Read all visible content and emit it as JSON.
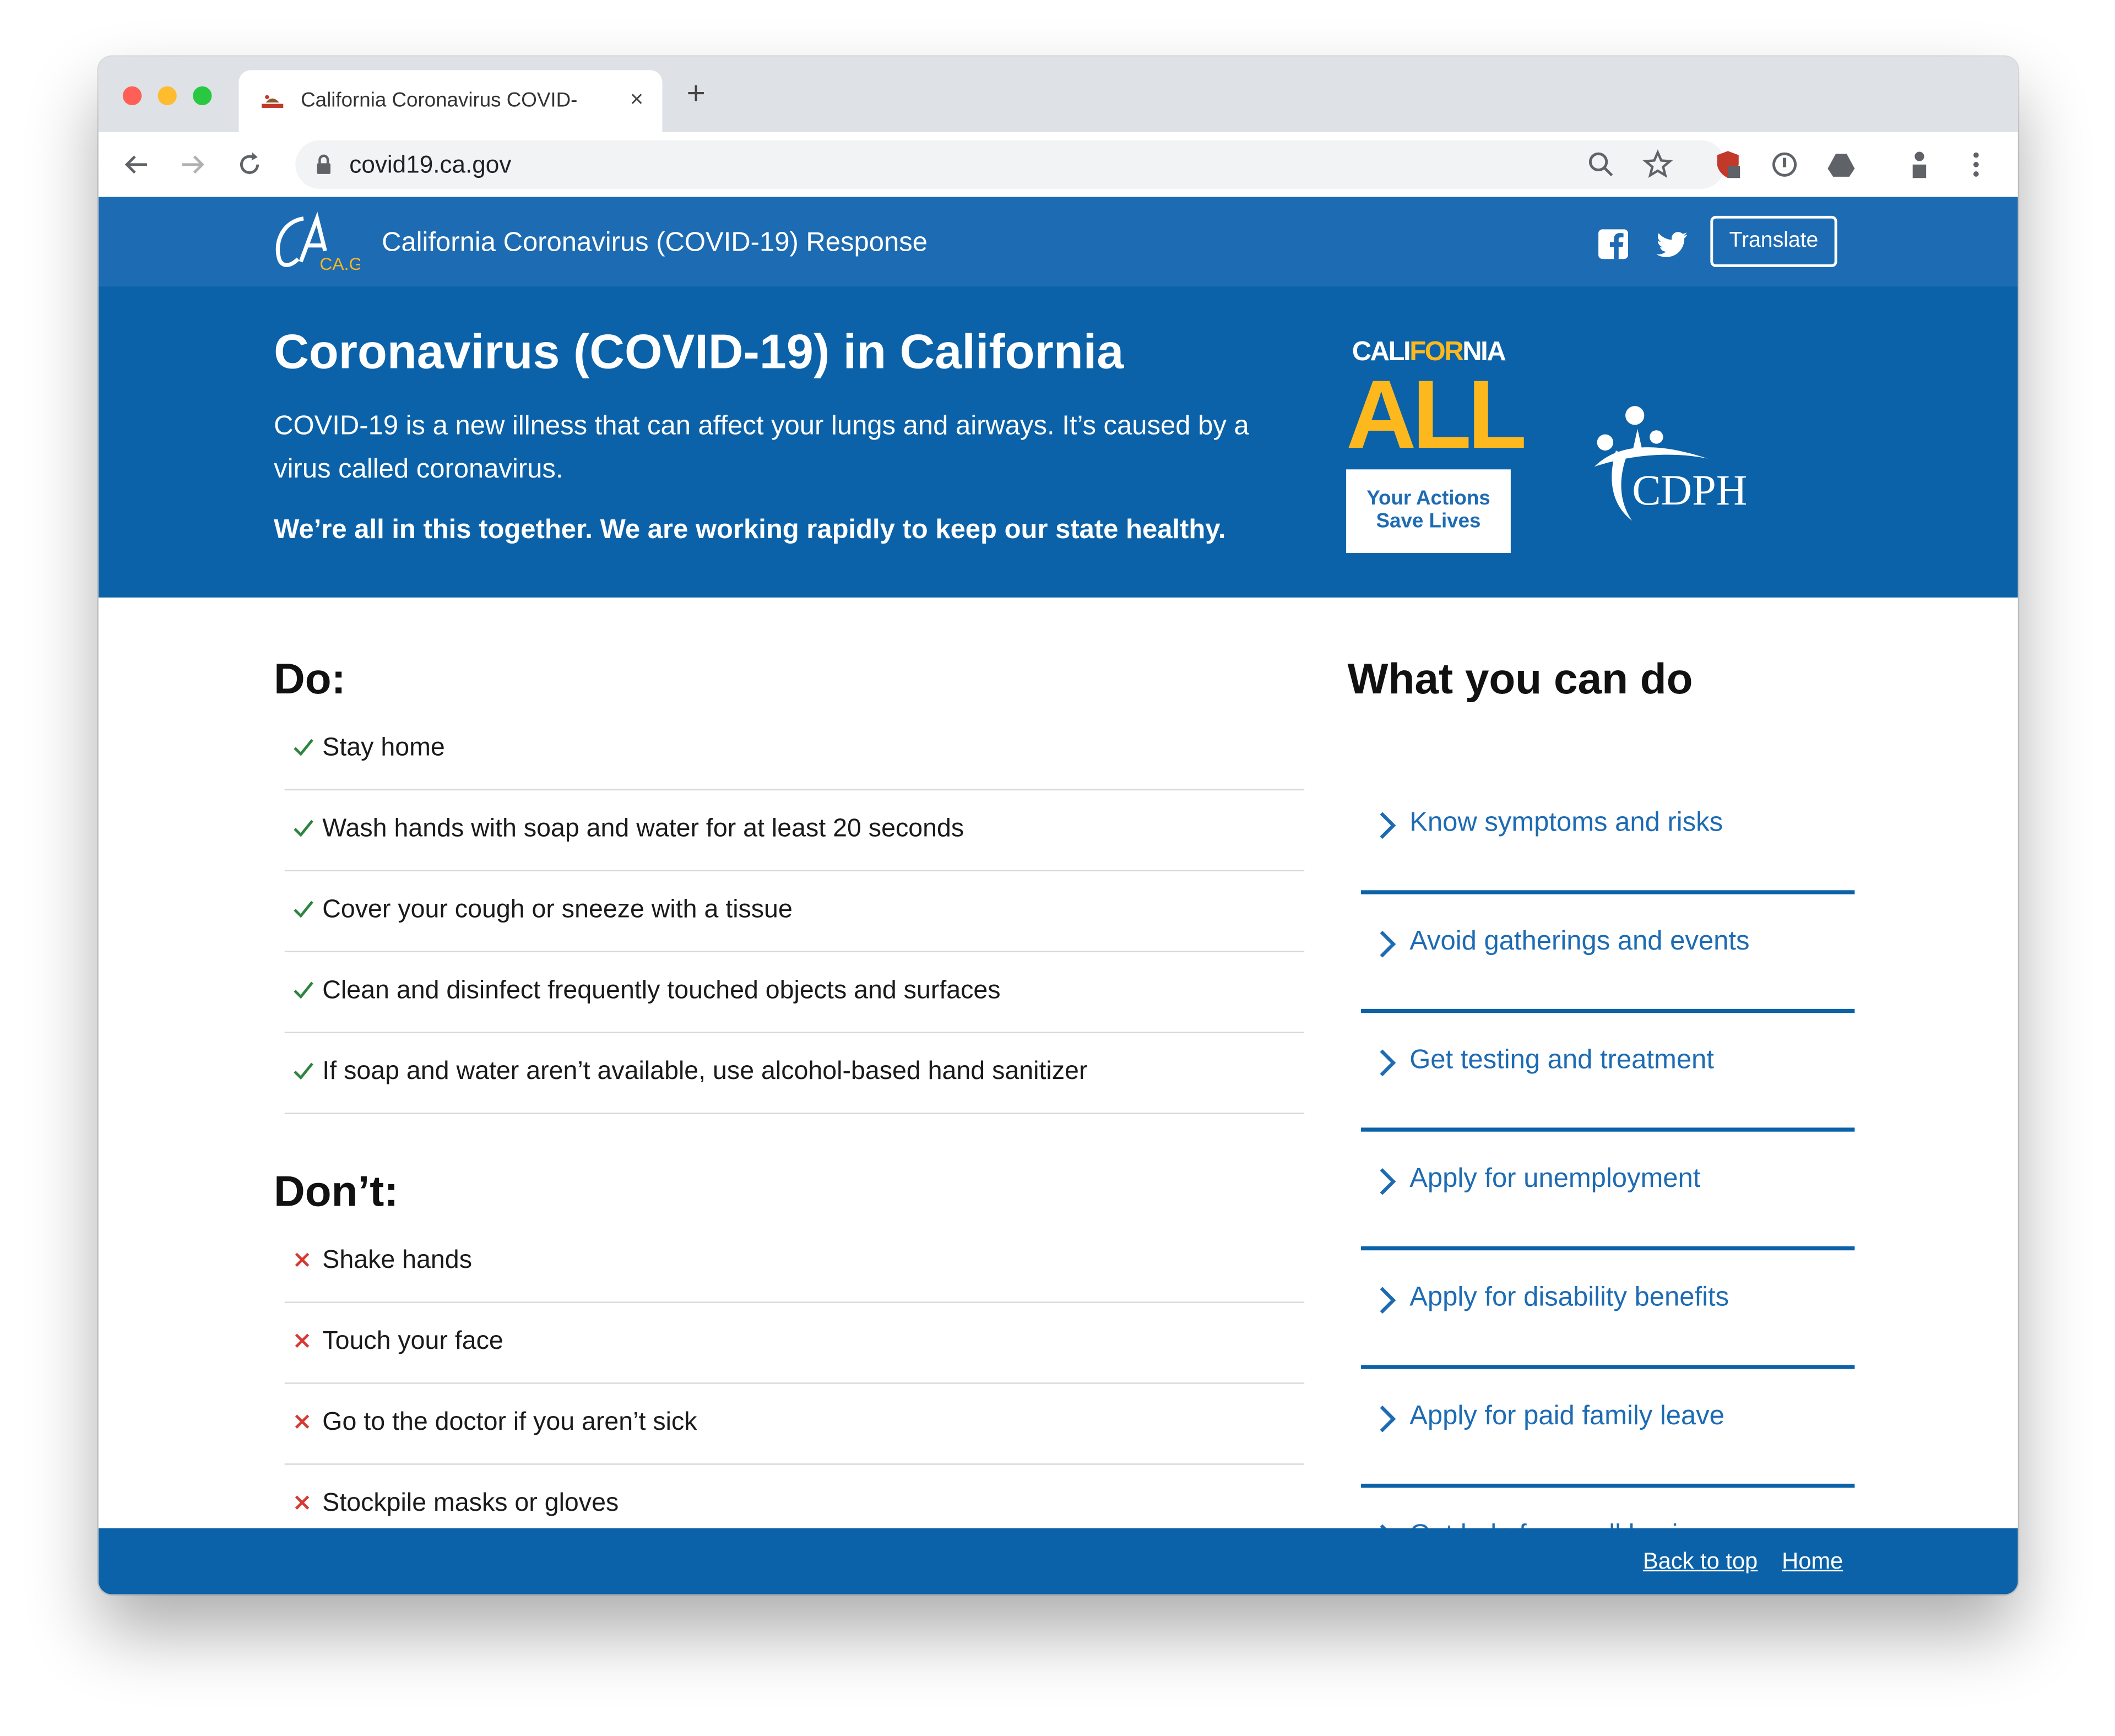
{
  "browser": {
    "tab_title": "California Coronavirus COVID-",
    "tab_close": "×",
    "new_tab": "+",
    "url": "covid19.ca.gov"
  },
  "header": {
    "logo_text": "CA.GOV",
    "site_title": "California Coronavirus (COVID-19) Response",
    "translate_label": "Translate"
  },
  "hero": {
    "title": "Coronavirus (COVID-19) in California",
    "description": "COVID-19 is a new illness that can affect your lungs and airways. It’s caused by a virus called coronavirus.",
    "tagline": "We’re all in this together. We are working rapidly to keep our state healthy.",
    "ca_all": {
      "word_a": "CALI",
      "word_b": "FOR",
      "word_c": "NIA",
      "big": "ALL",
      "box_line1": "Your Actions",
      "box_line2": "Save Lives"
    },
    "cdph_text": "CDPH"
  },
  "do_section": {
    "heading": "Do:",
    "items": [
      "Stay home",
      "Wash hands with soap and water for at least 20 seconds",
      "Cover your cough or sneeze with a tissue",
      "Clean and disinfect frequently touched objects and surfaces",
      "If soap and water aren’t available, use alcohol-based hand sanitizer"
    ]
  },
  "dont_section": {
    "heading": "Don’t:",
    "items": [
      "Shake hands",
      "Touch your face",
      "Go to the doctor if you aren’t sick",
      "Stockpile masks or gloves"
    ]
  },
  "sidebar": {
    "heading": "What you can do",
    "links": [
      "Know symptoms and risks",
      "Avoid gatherings and events",
      "Get testing and treatment",
      "Apply for unemployment",
      "Apply for disability benefits",
      "Apply for paid family leave",
      "Get help for small businesses"
    ]
  },
  "footer": {
    "back_to_top": "Back to top",
    "home": "Home"
  },
  "colors": {
    "header_blue": "#1d6bb3",
    "hero_blue": "#0b62a8",
    "accent_gold": "#fdb81e",
    "check_green": "#2e8540",
    "x_red": "#d83933"
  },
  "icons": {
    "back": "arrow-left-icon",
    "forward": "arrow-right-icon",
    "reload": "reload-icon",
    "lock": "lock-icon",
    "zoom": "magnifier-icon",
    "bookmark": "star-icon",
    "extensions": [
      "shield-extension-icon",
      "password-extension-icon",
      "drive-extension-icon",
      "profile-extension-icon"
    ],
    "menu": "kebab-menu-icon",
    "facebook": "facebook-icon",
    "twitter": "twitter-icon",
    "check": "check-icon",
    "cross": "x-icon",
    "chevron": "chevron-right-icon"
  }
}
